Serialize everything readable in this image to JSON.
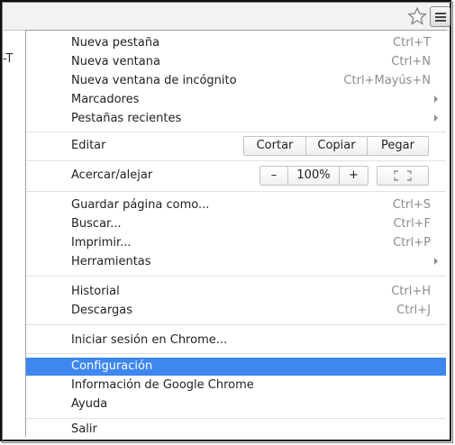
{
  "page": {
    "behind_fragment": "-T"
  },
  "toolbar": {
    "bookmark_icon": "star-outline-icon",
    "menu_icon": "hamburger-menu-icon"
  },
  "menu": {
    "highlight_color": "#3e86f0",
    "shortcut_color": "#8c8c8c",
    "group1": [
      {
        "label": "Nueva pestaña",
        "shortcut": "Ctrl+T"
      },
      {
        "label": "Nueva ventana",
        "shortcut": "Ctrl+N"
      },
      {
        "label": "Nueva ventana de incógnito",
        "shortcut": "Ctrl+Mayús+N"
      },
      {
        "label": "Marcadores",
        "shortcut": "",
        "submenu": true
      },
      {
        "label": "Pestañas recientes",
        "shortcut": "",
        "submenu": true
      }
    ],
    "edit": {
      "label": "Editar",
      "cut": "Cortar",
      "copy": "Copiar",
      "paste": "Pegar"
    },
    "zoom": {
      "label": "Acercar/alejar",
      "minus": "–",
      "value": "100%",
      "plus": "+",
      "fullscreen_icon": "fullscreen-icon"
    },
    "group3": [
      {
        "label": "Guardar página como...",
        "shortcut": "Ctrl+S"
      },
      {
        "label": "Buscar...",
        "shortcut": "Ctrl+F"
      },
      {
        "label": "Imprimir...",
        "shortcut": "Ctrl+P"
      },
      {
        "label": "Herramientas",
        "shortcut": "",
        "submenu": true
      }
    ],
    "group4": [
      {
        "label": "Historial",
        "shortcut": "Ctrl+H"
      },
      {
        "label": "Descargas",
        "shortcut": "Ctrl+J"
      }
    ],
    "signin": "Iniciar sesión en Chrome...",
    "group6": [
      {
        "label": "Configuración",
        "highlighted": true
      },
      {
        "label": "Información de Google Chrome"
      },
      {
        "label": "Ayuda"
      }
    ],
    "exit": "Salir"
  }
}
